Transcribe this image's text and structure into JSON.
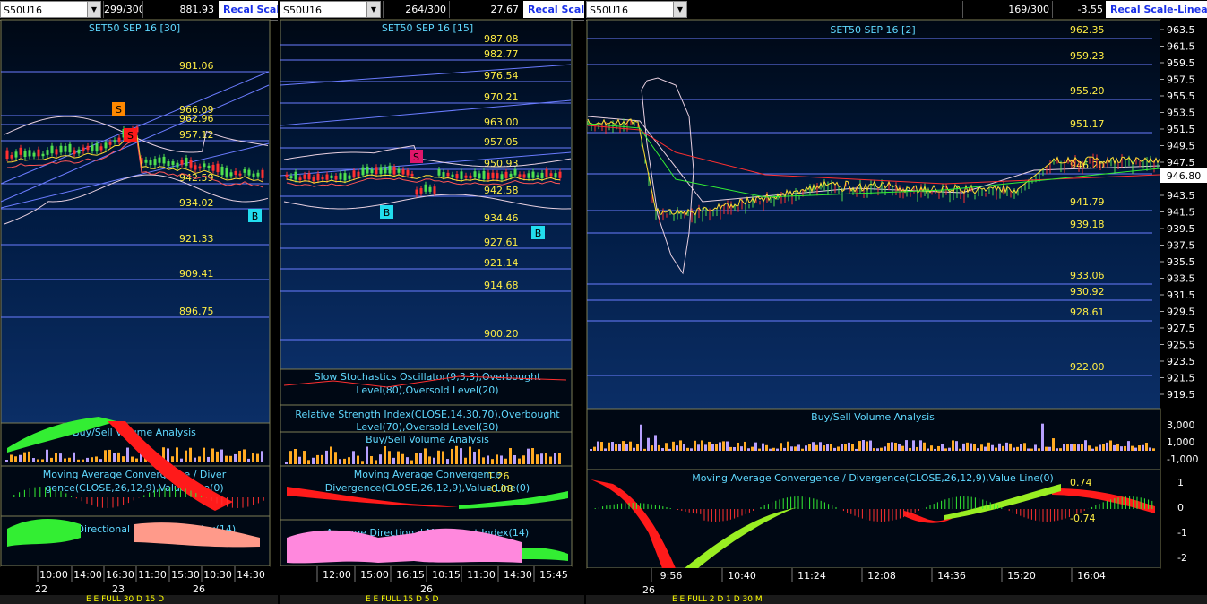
{
  "panels": [
    {
      "symbol": "S50U16",
      "count": "299/300",
      "price": "881.93",
      "recal": "Recal Scale",
      "chart_title": "SET50 SEP 16  [30]",
      "levels": [
        "981.06",
        "966.09",
        "962.96",
        "957.12",
        "942.59",
        "934.02",
        "921.33",
        "909.41",
        "896.75"
      ],
      "signals": [
        "S",
        "S",
        "B"
      ],
      "indicators": [
        "Buy/Sell Volume Analysis",
        "Moving Average Convergence / Divergence(CLOSE,26,12,9),Value Line(0)",
        "Average Directional Movement Index(14)"
      ],
      "time_labels": [
        "10:00",
        "14:00",
        "16:30",
        "11:30",
        "15:30",
        "10:30",
        "14:30"
      ],
      "date_labels": [
        "22",
        "23",
        "26"
      ],
      "status": "E  E     FULL    30 D    15 D"
    },
    {
      "symbol": "S50U16",
      "count": "264/300",
      "price": "27.67",
      "recal": "Recal Scale",
      "chart_title": "SET50 SEP 16  [15]",
      "levels": [
        "987.08",
        "982.77",
        "976.54",
        "970.21",
        "963.00",
        "957.05",
        "950.93",
        "942.58",
        "934.46",
        "927.61",
        "921.14",
        "914.68",
        "900.20"
      ],
      "signals": [
        "S",
        "B",
        "B"
      ],
      "indicators": [
        "Slow Stochastics Oscillator(9,3,3),Overbought Level(80),Oversold Level(20)",
        "Relative Strength Index(CLOSE,14,30,70),Overbought Level(70),Oversold Level(30)",
        "Buy/Sell Volume Analysis",
        "Moving Average Convergence / Divergence(CLOSE,26,12,9),Value Line(0)",
        "Average Directional Movement Index(14)"
      ],
      "macd_labels": [
        "1.26",
        "-0.08"
      ],
      "time_labels": [
        "12:00",
        "15:00",
        "16:15",
        "10:15",
        "11:30",
        "14:30",
        "15:45"
      ],
      "date_labels": [
        "26"
      ],
      "status": "E  E     FULL    15 D    5 D"
    },
    {
      "symbol": "S50U16",
      "count": "169/300",
      "price": "-3.55",
      "recal": "Recal Scale-Linear",
      "chart_title": "SET50 SEP 16  [2]",
      "levels": [
        "962.35",
        "959.23",
        "955.20",
        "951.17",
        "946.20",
        "941.79",
        "939.18",
        "933.06",
        "930.92",
        "928.61",
        "922.00"
      ],
      "axis": [
        "963.5",
        "961.5",
        "959.5",
        "957.5",
        "955.5",
        "953.5",
        "951.5",
        "949.5",
        "947.5",
        "945.5",
        "943.5",
        "941.5",
        "939.5",
        "937.5",
        "935.5",
        "933.5",
        "931.5",
        "929.5",
        "927.5",
        "925.5",
        "923.5",
        "921.5",
        "919.5"
      ],
      "last_price": "946.80",
      "indicators": [
        "Buy/Sell Volume Analysis",
        "Moving Average Convergence / Divergence(CLOSE,26,12,9),Value Line(0)"
      ],
      "vol_axis": [
        "3,000",
        "1,000",
        "-1,000"
      ],
      "macd_axis": [
        "1",
        "0",
        "-1",
        "-2"
      ],
      "macd_labels": [
        "0.74",
        "-0.74"
      ],
      "time_labels": [
        "9:56",
        "10:40",
        "11:24",
        "12:08",
        "14:36",
        "15:20",
        "16:04"
      ],
      "date_labels": [
        "26"
      ],
      "status": "E  E     FULL    2 D    1 D    30 M"
    }
  ]
}
